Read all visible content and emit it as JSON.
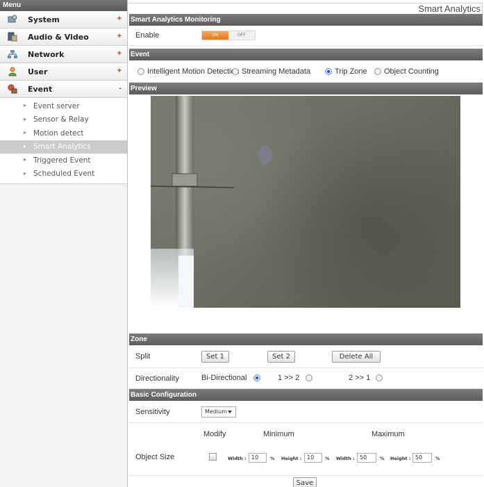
{
  "sidebar": {
    "header": "Menu",
    "items": [
      {
        "label": "System",
        "marker": "+",
        "icon": "system-icon"
      },
      {
        "label": "Audio & Video",
        "marker": "+",
        "icon": "audio-video-icon"
      },
      {
        "label": "Network",
        "marker": "+",
        "icon": "network-icon"
      },
      {
        "label": "User",
        "marker": "+",
        "icon": "user-icon"
      },
      {
        "label": "Event",
        "marker": "-",
        "icon": "event-icon"
      }
    ],
    "submenu": [
      "Event server",
      "Sensor & Relay",
      "Motion detect",
      "Smart Analytics",
      "Triggered Event",
      "Scheduled Event"
    ]
  },
  "page_title": "Smart Analytics",
  "monitoring": {
    "section": "Smart Analytics Monitoring",
    "enable_label": "Enable",
    "toggle_on": "ON",
    "toggle_off": "OFF"
  },
  "event": {
    "section": "Event",
    "options": [
      "Intelligent Motion Detection",
      "Streaming Metadata",
      "Trip Zone",
      "Object Counting"
    ],
    "selected": "Trip Zone"
  },
  "preview": {
    "section": "Preview"
  },
  "zone": {
    "section": "Zone",
    "split_label": "Split",
    "set1": "Set 1",
    "set2": "Set 2",
    "delete_all": "Delete All",
    "direction_label": "Directionality",
    "bi_directional": "Bi-Directional",
    "one_to_two": "1 >> 2",
    "two_to_one": "2 >> 1",
    "selected": "Bi-Directional"
  },
  "basic": {
    "section": "Basic Configuration",
    "sensitivity_label": "Sensitivity",
    "sensitivity_value": "Medium",
    "modify_label": "Modify",
    "minimum_label": "Minimum",
    "maximum_label": "Maximum",
    "object_size_label": "Object Size",
    "width_label": "Width :",
    "height_label": "Height :",
    "percent": "%",
    "min_width": "10",
    "min_height": "10",
    "max_width": "50",
    "max_height": "50",
    "save": "Save"
  }
}
